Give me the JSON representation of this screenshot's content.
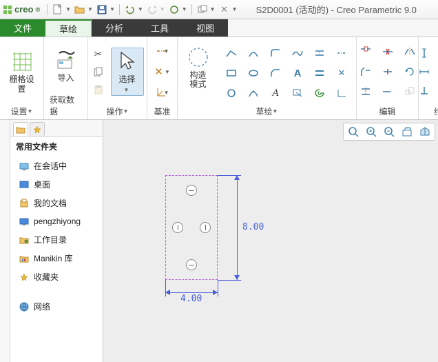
{
  "app": {
    "brand": "creo",
    "title": "S2D0001 (活动的) - Creo Parametric 9.0"
  },
  "tabs": {
    "file": "文件",
    "sketch": "草绘",
    "analysis": "分析",
    "tools": "工具",
    "view": "视图"
  },
  "ribbon": {
    "grid": {
      "label": "栅格设置",
      "group": "设置"
    },
    "import": {
      "label": "导入",
      "group": "获取数据"
    },
    "select": {
      "label": "选择",
      "group": "操作"
    },
    "datum": {
      "group": "基准"
    },
    "construct": {
      "label": "构造模式",
      "group": "草绘"
    },
    "edit": {
      "group": "编辑"
    },
    "constrain": {
      "group": "约束"
    }
  },
  "sidebar": {
    "header": "常用文件夹",
    "items": [
      {
        "label": "在会话中"
      },
      {
        "label": "桌面"
      },
      {
        "label": "我的文档"
      },
      {
        "label": "pengzhiyong"
      },
      {
        "label": "工作目录"
      },
      {
        "label": "Manikin 库"
      },
      {
        "label": "收藏夹"
      }
    ],
    "network": "网络"
  },
  "dimensions": {
    "width": "4.00",
    "height": "8.00"
  }
}
